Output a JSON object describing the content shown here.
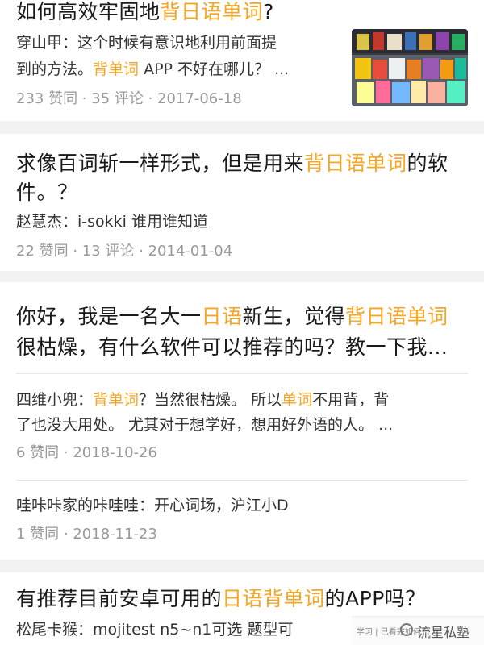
{
  "colors": {
    "highlight": "#f5a623",
    "meta": "#999999",
    "background": "#f2f2f2"
  },
  "cards": [
    {
      "title_parts": [
        "如何高效牢固地",
        "背日语单词",
        "?"
      ],
      "excerpt_line1_parts": [
        "穿山甲：这个时候有意识地利用前面提"
      ],
      "excerpt_line2_parts": [
        "到的方法。",
        "背单词",
        " APP 不好在哪儿？ ..."
      ],
      "meta": "233 赞同 · 35 评论 · 2017-06-18",
      "thumbnail_icon": "bookstore-photo-icon"
    },
    {
      "title_line1_parts": [
        "求像百词斩一样形式，但是用来",
        "背日语单词",
        "的软"
      ],
      "title_line2": "件。？",
      "excerpt": "赵慧杰：i-sokki 谁用谁知道",
      "meta": "22 赞同 · 13 评论 · 2014-01-04"
    },
    {
      "title_line1_parts": [
        "你好，我是一名大一",
        "日语",
        "新生，觉得",
        "背日语单词"
      ],
      "title_line2": "很枯燥，有什么软件可以推荐的吗？教一下我...",
      "answers": [
        {
          "line1_parts": [
            "四维小兜：",
            "背单词",
            "？当然很枯燥。 所以",
            "单词",
            "不用背，背"
          ],
          "line2": "了也没大用处。 尤其对于想学好，想用好外语的人。 ...",
          "meta": "6 赞同 · 2018-10-26"
        },
        {
          "line1": "哇咔咔家的咔哇哇：开心词场，沪江小D",
          "meta": "1 赞同 · 2018-11-23"
        }
      ]
    },
    {
      "title_parts": [
        "有推荐目前安卓可用的",
        "日语背单词",
        "的APP吗？"
      ],
      "excerpt": "松尾卡猴：mojitest n5~n1可选 题型可"
    }
  ],
  "watermark": {
    "tab_text": "学习 | 已看完如何",
    "logo_text": "流星私塾"
  }
}
